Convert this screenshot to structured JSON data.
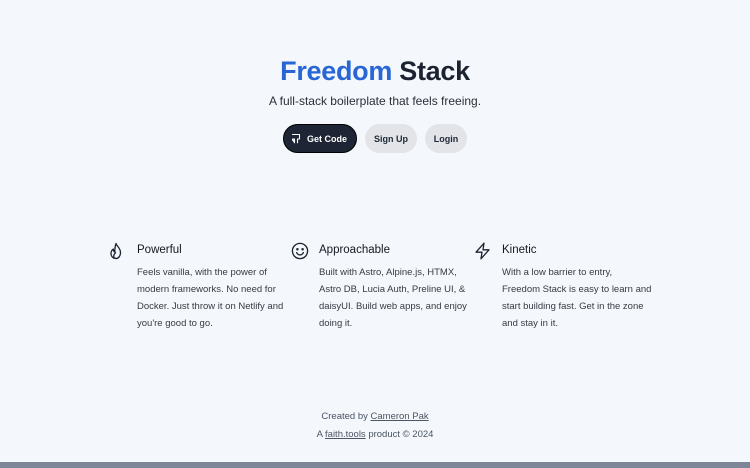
{
  "hero": {
    "title_accent": "Freedom",
    "title_rest": "Stack",
    "subtitle": "A full-stack boilerplate that feels freeing."
  },
  "buttons": {
    "get_code": "Get Code",
    "sign_up": "Sign Up",
    "login": "Login"
  },
  "features": [
    {
      "icon": "flame-icon",
      "title": "Powerful",
      "description": "Feels vanilla, with the power of modern frameworks. No need for Docker. Just throw it on Netlify and you're good to go."
    },
    {
      "icon": "smiley-icon",
      "title": "Approachable",
      "description": "Built with Astro, Alpine.js, HTMX, Astro DB, Lucia Auth, Preline UI, & daisyUI. Build web apps, and enjoy doing it."
    },
    {
      "icon": "lightning-icon",
      "title": "Kinetic",
      "description": "With a low barrier to entry, Freedom Stack is easy to learn and start building fast. Get in the zone and stay in it."
    }
  ],
  "footer": {
    "created_by": "Created by",
    "author": "Cameron Pak",
    "a_prefix": "A",
    "product_link": "faith.tools",
    "product_suffix": "product © 2024"
  },
  "colors": {
    "accent": "#2866d6",
    "background": "#f4f7fb",
    "primary_button": "#1e2535",
    "secondary_button": "#e2e4e8"
  }
}
